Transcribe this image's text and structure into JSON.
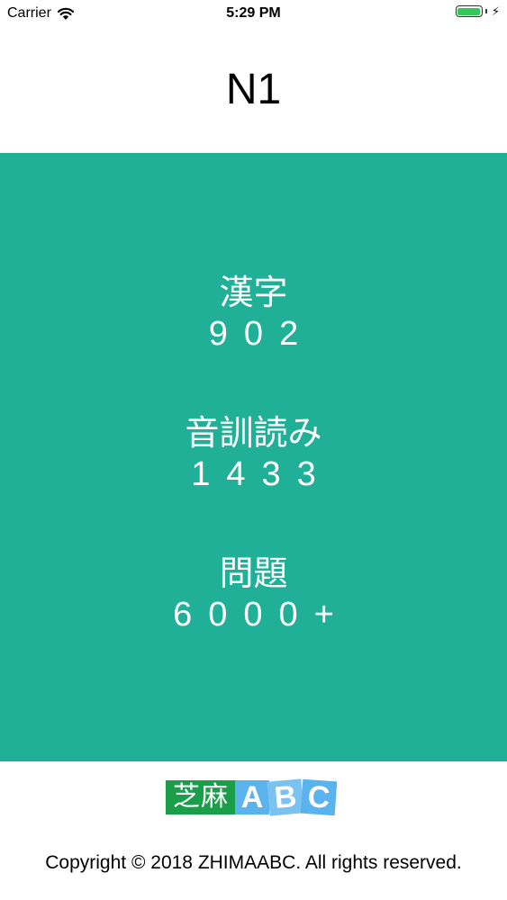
{
  "status_bar": {
    "carrier": "Carrier",
    "time": "5:29 PM",
    "battery_level": 1.0,
    "icons": [
      "wifi-icon",
      "battery-icon",
      "charging-bolt-icon"
    ]
  },
  "nav": {
    "title": "N1"
  },
  "stats": {
    "kanji": {
      "label": "漢字",
      "value": "902"
    },
    "reading": {
      "label": "音訓読み",
      "value": "1433"
    },
    "questions": {
      "label": "問題",
      "value": "6000+"
    }
  },
  "logo": {
    "chinese": "芝麻",
    "letters": [
      "A",
      "B",
      "C"
    ]
  },
  "footer": {
    "copyright": "Copyright © 2018 ZHIMAABC. All rights reserved."
  },
  "colors": {
    "panel": "#20b097",
    "logo_green": "#1a9e49",
    "logo_blue": "#5ab3ec",
    "battery": "#34c759"
  }
}
